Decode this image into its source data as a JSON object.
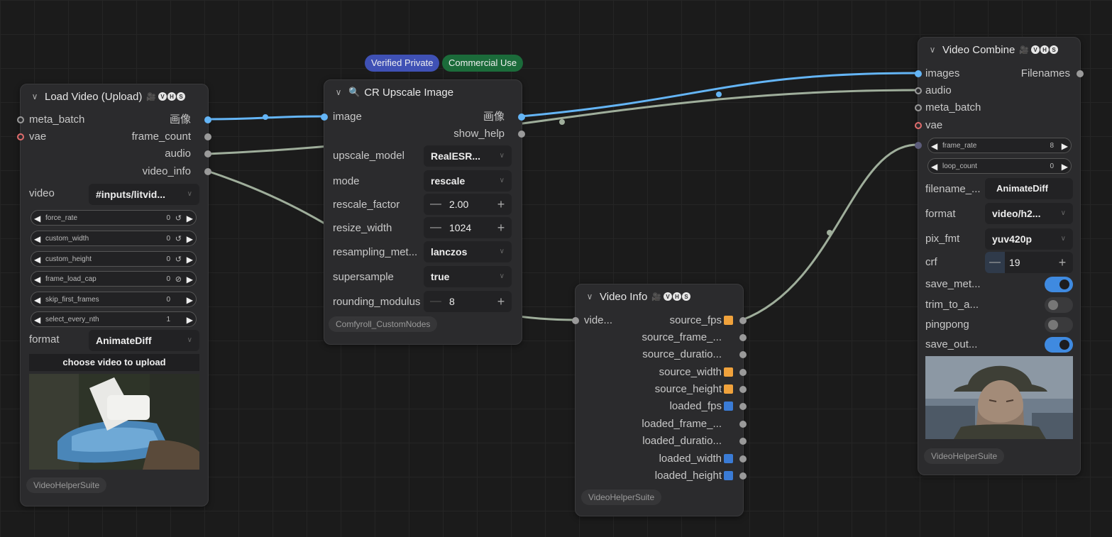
{
  "badges": {
    "verified": "Verified Private",
    "commercial": "Commercial Use"
  },
  "load_video": {
    "title": "Load Video (Upload)",
    "inputs": [
      "meta_batch",
      "vae"
    ],
    "outputs": [
      "画像",
      "frame_count",
      "audio",
      "video_info"
    ],
    "video_label": "video",
    "video_value": "#inputs/litvid...",
    "widgets": [
      {
        "name": "force_rate",
        "value": "0",
        "icon": "↺"
      },
      {
        "name": "custom_width",
        "value": "0",
        "icon": "↺"
      },
      {
        "name": "custom_height",
        "value": "0",
        "icon": "↺"
      },
      {
        "name": "frame_load_cap",
        "value": "0",
        "icon": "⊘"
      },
      {
        "name": "skip_first_frames",
        "value": "0",
        "icon": ""
      },
      {
        "name": "select_every_nth",
        "value": "1",
        "icon": ""
      }
    ],
    "format_label": "format",
    "format_value": "AnimateDiff",
    "upload_button": "choose video to upload",
    "footer": "VideoHelperSuite"
  },
  "upscale": {
    "title": "CR Upscale Image",
    "input": "image",
    "outputs": [
      "画像",
      "show_help"
    ],
    "upscale_model_label": "upscale_model",
    "upscale_model_value": "RealESR...",
    "mode_label": "mode",
    "mode_value": "rescale",
    "rescale_factor_label": "rescale_factor",
    "rescale_factor_value": "2.00",
    "resize_width_label": "resize_width",
    "resize_width_value": "1024",
    "resampling_label": "resampling_met...",
    "resampling_value": "lanczos",
    "supersample_label": "supersample",
    "supersample_value": "true",
    "rounding_label": "rounding_modulus",
    "rounding_value": "8",
    "footer": "Comfyroll_CustomNodes"
  },
  "video_info": {
    "title": "Video Info",
    "input": "vide...",
    "outputs": [
      {
        "name": "source_fps",
        "color": "orange"
      },
      {
        "name": "source_frame_...",
        "color": ""
      },
      {
        "name": "source_duratio...",
        "color": ""
      },
      {
        "name": "source_width",
        "color": "orange"
      },
      {
        "name": "source_height",
        "color": "orange"
      },
      {
        "name": "loaded_fps",
        "color": "blue"
      },
      {
        "name": "loaded_frame_...",
        "color": ""
      },
      {
        "name": "loaded_duratio...",
        "color": ""
      },
      {
        "name": "loaded_width",
        "color": "blue"
      },
      {
        "name": "loaded_height",
        "color": "blue"
      }
    ],
    "footer": "VideoHelperSuite"
  },
  "video_combine": {
    "title": "Video Combine",
    "inputs": [
      "images",
      "audio",
      "meta_batch",
      "vae"
    ],
    "output": "Filenames",
    "frame_rate_label": "frame_rate",
    "frame_rate_value": "8",
    "loop_count_label": "loop_count",
    "loop_count_value": "0",
    "filename_label": "filename_...",
    "filename_value": "AnimateDiff",
    "format_label": "format",
    "format_value": "video/h2...",
    "pix_fmt_label": "pix_fmt",
    "pix_fmt_value": "yuv420p",
    "crf_label": "crf",
    "crf_value": "19",
    "save_meta_label": "save_met...",
    "save_meta_on": true,
    "trim_label": "trim_to_a...",
    "trim_on": false,
    "pingpong_label": "pingpong",
    "pingpong_on": false,
    "save_out_label": "save_out...",
    "save_out_on": true,
    "footer": "VideoHelperSuite"
  },
  "colors": {
    "image_link": "#64b5f6",
    "other_link": "#9fae9b",
    "badge_blue": "#3f51b5",
    "badge_green": "#1b6b3a"
  }
}
